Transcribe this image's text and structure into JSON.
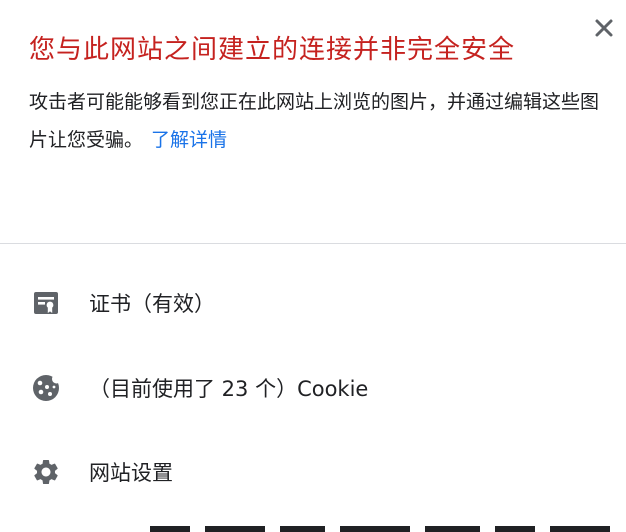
{
  "popup": {
    "title": "您与此网站之间建立的连接并非完全安全",
    "description": "攻击者可能能够看到您正在此网站上浏览的图片，并通过编辑这些图片让您受骗。",
    "learn_more_link": "了解详情",
    "close_icon": "close-icon"
  },
  "rows": {
    "certificate": {
      "icon": "certificate-icon",
      "label": "证书（有效）"
    },
    "cookies": {
      "icon": "cookie-icon",
      "label": "（目前使用了 23 个）Cookie"
    },
    "site_settings": {
      "icon": "gear-icon",
      "label": "网站设置"
    }
  },
  "colors": {
    "warning_title": "#c5221f",
    "link": "#1a73e8",
    "text": "#202124",
    "icon": "#5f6368",
    "divider": "#dadce0"
  }
}
